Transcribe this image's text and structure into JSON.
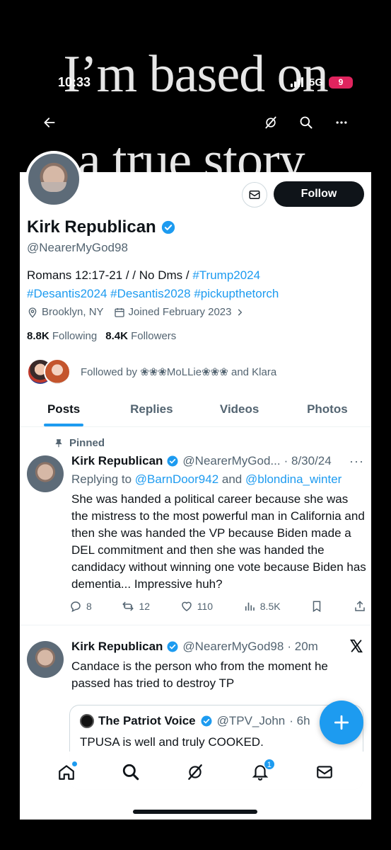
{
  "meme": {
    "line1": "I’m based on",
    "line2": "a true story."
  },
  "status_bar": {
    "time": "10:33",
    "network": "5G",
    "battery": "9"
  },
  "profile": {
    "name": "Kirk Republican",
    "handle": "@NearerMyGod98",
    "bio_plain": "Romans 12:17-21 / / No Dms / ",
    "bio_tags": [
      "#Trump2024",
      "#Desantis2024",
      "#Desantis2028",
      "#pickupthetorch"
    ],
    "location": "Brooklyn, NY",
    "joined": "Joined February 2023",
    "following_count": "8.8K",
    "following_label": "Following",
    "followers_count": "8.4K",
    "followers_label": "Followers",
    "followed_by": "Followed by ❀❀❀MoLLie❀❀❀ and Klara",
    "follow_button": "Follow"
  },
  "tabs": [
    "Posts",
    "Replies",
    "Videos",
    "Photos"
  ],
  "tweets": [
    {
      "pinned_label": "Pinned",
      "name": "Kirk Republican",
      "handle": "@NearerMyGod...",
      "time": "· 8/30/24",
      "reply_prefix": "Replying to ",
      "reply_user1": "@BarnDoor942",
      "reply_and": " and ",
      "reply_user2": "@blondina_winter",
      "body": "She was handed a political career because she was the mistress to the most powerful man in California and then she was handed the VP because Biden made a DEL commitment and then she was handed the candidacy without winning one vote because Biden has dementia... Impressive huh?",
      "replies": "8",
      "reposts": "12",
      "likes": "110",
      "views": "8.5K"
    },
    {
      "name": "Kirk Republican",
      "handle": "@NearerMyGod98",
      "time": "· 20m",
      "body": "Candace is the person who from the moment he passed has tried to destroy TP",
      "quote": {
        "name": "The Patriot Voice",
        "handle": "@TPV_John",
        "time": "· 6h",
        "body": "TPUSA is well and truly COOKED."
      }
    }
  ],
  "bottom_nav": {
    "notifications_badge": "1"
  },
  "colors": {
    "accent": "#1d9bf0",
    "text": "#0f1419",
    "muted": "#536471"
  }
}
